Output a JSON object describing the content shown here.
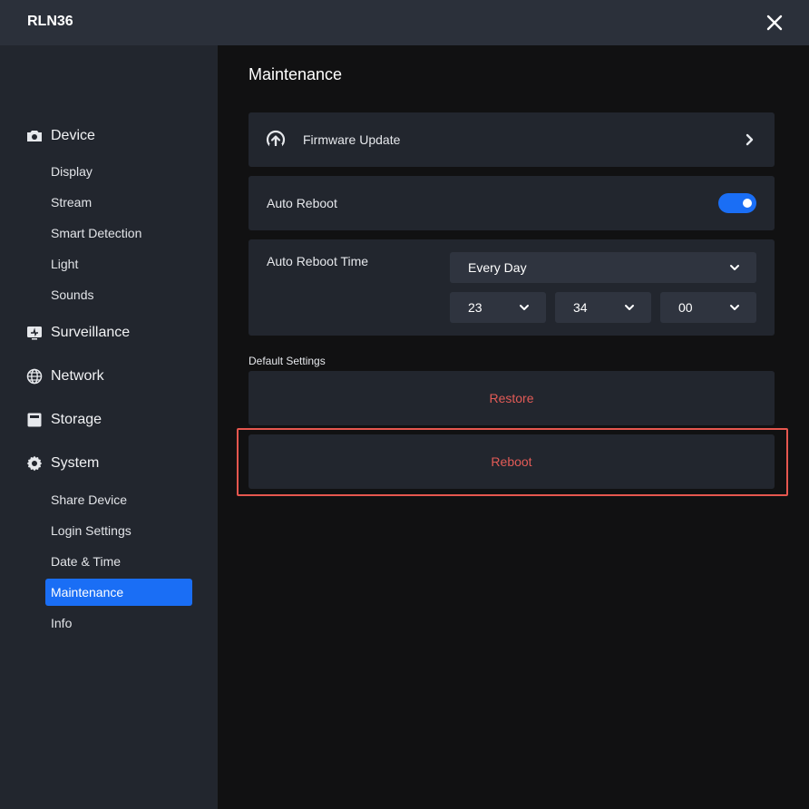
{
  "window": {
    "title": "RLN36"
  },
  "sidebar": {
    "sections": [
      {
        "label": "Device",
        "icon": "camera-icon",
        "items": [
          "Display",
          "Stream",
          "Smart Detection",
          "Light",
          "Sounds"
        ]
      },
      {
        "label": "Surveillance",
        "icon": "monitor-icon",
        "items": []
      },
      {
        "label": "Network",
        "icon": "globe-icon",
        "items": []
      },
      {
        "label": "Storage",
        "icon": "storage-icon",
        "items": []
      },
      {
        "label": "System",
        "icon": "gear-icon",
        "items": [
          "Share Device",
          "Login Settings",
          "Date & Time",
          "Maintenance",
          "Info"
        ]
      }
    ],
    "active_item": "Maintenance"
  },
  "main": {
    "title": "Maintenance",
    "firmware_update": {
      "label": "Firmware Update",
      "icon": "upload-cloud-icon"
    },
    "auto_reboot": {
      "label": "Auto Reboot",
      "enabled": true
    },
    "auto_reboot_time": {
      "label": "Auto Reboot Time",
      "frequency": "Every Day",
      "hour": "23",
      "minute": "34",
      "second": "00"
    },
    "default_settings": {
      "label": "Default Settings",
      "restore_label": "Restore",
      "reboot_label": "Reboot"
    }
  },
  "colors": {
    "accent": "#1a6ef5",
    "danger_text": "#e25b57",
    "highlight": "#e6574f"
  }
}
